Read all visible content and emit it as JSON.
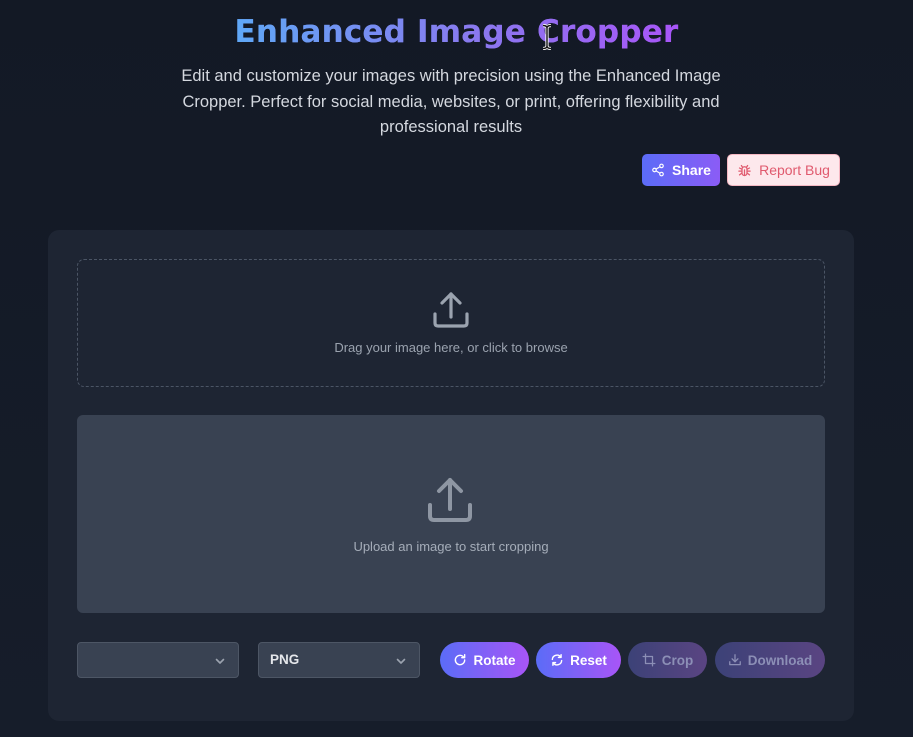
{
  "header": {
    "title": "Enhanced Image Cropper",
    "description": "Edit and customize your images with precision using the Enhanced Image Cropper. Perfect for social media, websites, or print, offering flexibility and professional results"
  },
  "actions": {
    "share_label": "Share",
    "report_bug_label": "Report Bug"
  },
  "dropzone": {
    "text": "Drag your image here, or click to browse",
    "icon": "upload-icon"
  },
  "preview": {
    "text": "Upload an image to start cropping",
    "icon": "upload-icon"
  },
  "controls": {
    "aspect_ratio_value": "",
    "format_value": "PNG",
    "rotate_label": "Rotate",
    "reset_label": "Reset",
    "crop_label": "Crop",
    "download_label": "Download"
  },
  "colors": {
    "background": "#141a26",
    "panel": "#1e2533",
    "accent_start": "#5b6cf7",
    "accent_end": "#a855f7",
    "bug_text": "#e05a6e"
  }
}
